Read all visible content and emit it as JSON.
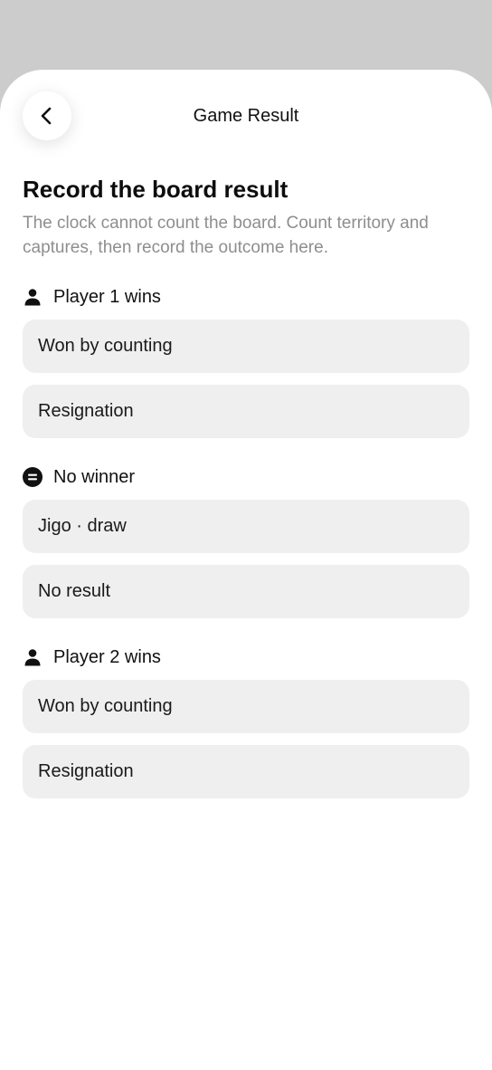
{
  "header": {
    "title": "Game Result",
    "back_icon": "chevron-left-icon"
  },
  "intro": {
    "heading": "Record the board result",
    "subtitle": "The clock cannot count the board. Count territory and captures, then record the outcome here."
  },
  "sections": [
    {
      "label": "Player 1 wins",
      "icon": "person-icon",
      "options": [
        "Won by counting",
        "Resignation"
      ]
    },
    {
      "label": "No winner",
      "icon": "equals-circle-icon",
      "options": [
        "Jigo · draw",
        "No result"
      ]
    },
    {
      "label": "Player 2 wins",
      "icon": "person-icon",
      "options": [
        "Won by counting",
        "Resignation"
      ]
    }
  ],
  "colors": {
    "backdrop": "#cccccc",
    "sheet": "#ffffff",
    "option_bg": "#efefef",
    "subtitle_text": "#8e8e8e"
  }
}
